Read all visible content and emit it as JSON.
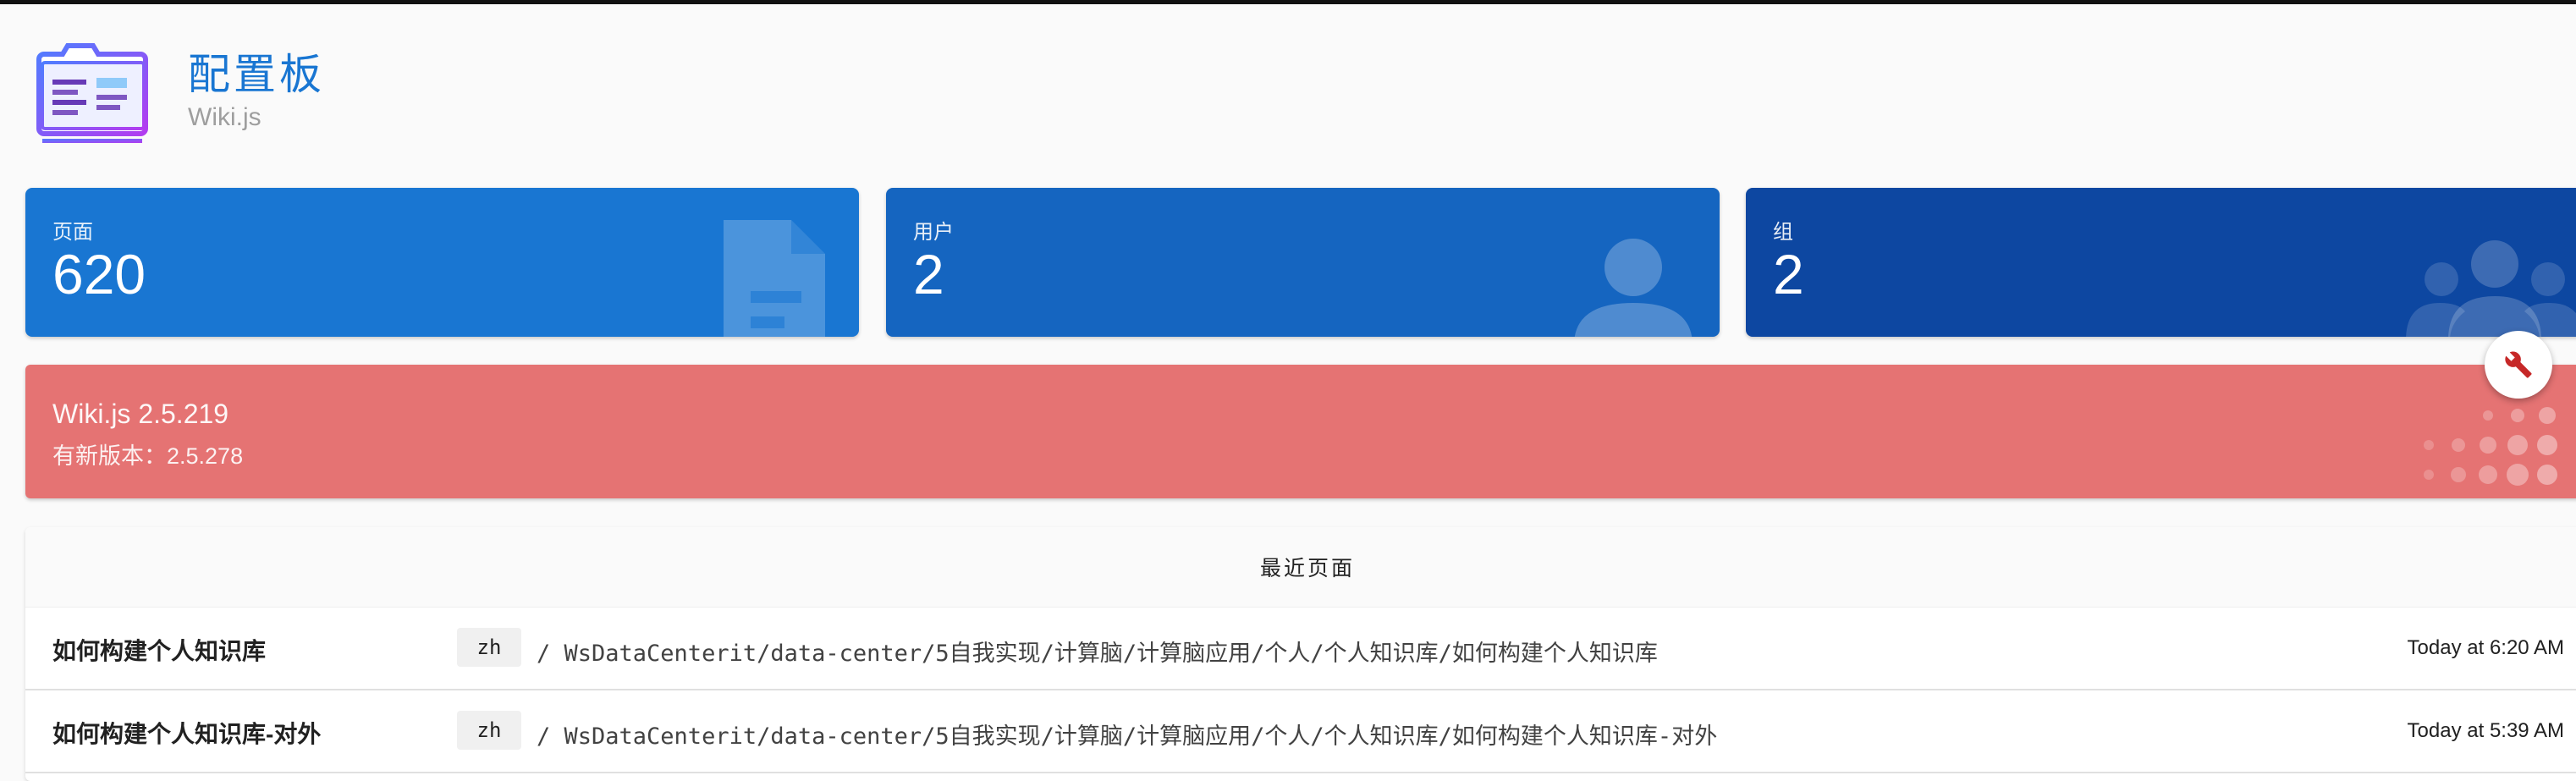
{
  "header": {
    "title": "配置板",
    "subtitle": "Wiki.js",
    "icon": "dashboard-window-icon"
  },
  "stats": {
    "pages": {
      "label": "页面",
      "value": "620",
      "icon": "file-document-icon",
      "color": "#1976d2"
    },
    "users": {
      "label": "用户",
      "value": "2",
      "icon": "account-icon",
      "color": "#1565c0"
    },
    "groups": {
      "label": "组",
      "value": "2",
      "icon": "account-group-icon",
      "color": "#0d47a1"
    }
  },
  "update": {
    "current_version": "Wiki.js 2.5.219",
    "available": "有新版本：2.5.278",
    "color": "#e57373",
    "fab_icon": "wrench-icon"
  },
  "recent": {
    "title": "最近页面",
    "rows": [
      {
        "title": "如何构建个人知识库",
        "locale": "zh",
        "path": "/ WsDataCenterit/data-center/5自我实现/计算脑/计算脑应用/个人/个人知识库/如何构建个人知识库",
        "time": "Today at 6:20 AM"
      },
      {
        "title": "如何构建个人知识库-对外",
        "locale": "zh",
        "path": "/ WsDataCenterit/data-center/5自我实现/计算脑/计算脑应用/个人/个人知识库/如何构建个人知识库-对外",
        "time": "Today at 5:39 AM"
      }
    ]
  }
}
